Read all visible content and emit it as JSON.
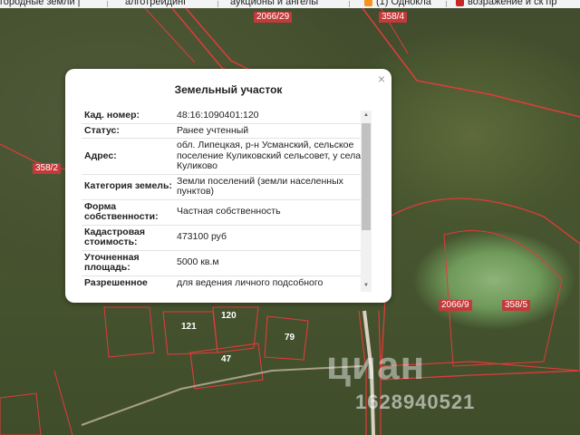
{
  "bookmarks": [
    {
      "label": "городные земли |"
    },
    {
      "label": "алготрейдинг"
    },
    {
      "label": "аукционы и ангелы"
    },
    {
      "label": "(1) Однокла"
    },
    {
      "label": "возражение и ск пр"
    }
  ],
  "map": {
    "parcel_labels": [
      "2066/29",
      "358/4",
      "358/2",
      "2066/9",
      "358/5"
    ],
    "house_labels": [
      "121",
      "120",
      "47",
      "79"
    ],
    "watermark": "циан",
    "watermark_id": "1628940521"
  },
  "popup": {
    "title": "Земельный участок",
    "close_glyph": "×",
    "rows": [
      {
        "key": "Кад. номер:",
        "value": "48:16:1090401:120"
      },
      {
        "key": "Статус:",
        "value": "Ранее учтенный"
      },
      {
        "key": "Адрес:",
        "value": "обл. Липецкая, р-н Усманский, сельское поселение Куликовский сельсовет, у села Куликово"
      },
      {
        "key": "Категория земель:",
        "value": "Земли поселений (земли населенных пунктов)"
      },
      {
        "key": "Форма собственности:",
        "value": "Частная собственность"
      },
      {
        "key": "Кадастровая стоимость:",
        "value": "473100 руб"
      },
      {
        "key": "Уточненная площадь:",
        "value": "5000 кв.м"
      },
      {
        "key": "Разрешенное",
        "value": "для ведения личного подсобного"
      }
    ]
  },
  "colors": {
    "parcel_border": "#e23b3b",
    "popup_bg": "#ffffff"
  }
}
